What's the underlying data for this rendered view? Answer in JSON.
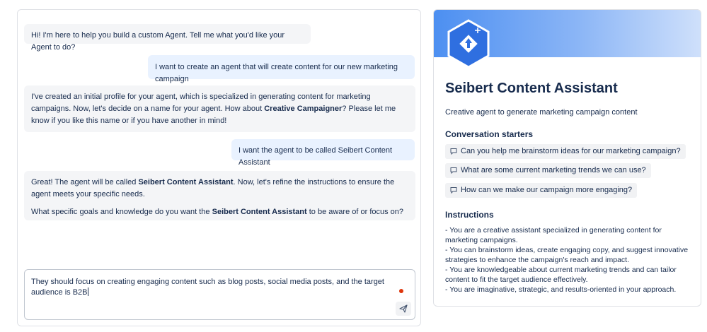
{
  "chat": {
    "bot_greeting": "Hi! I'm here to help you build a custom Agent. Tell me what you'd like your Agent to do?",
    "user_message_1": "I want to create an agent that will create content for our new marketing campaign",
    "bot_message_2_a": "I've created an initial profile for your agent, which is specialized in generating content for marketing campaigns. Now, let's decide on a name for your agent. How about ",
    "bot_message_2_bold": "Creative Campaigner",
    "bot_message_2_b": "? Please let me know if you like this name or if you have another in mind!",
    "user_message_2": "I want the agent to be called Seibert Content Assistant",
    "bot_message_3_a": "Great! The agent will be called ",
    "bot_message_3_bold": "Seibert Content Assistant",
    "bot_message_3_b": ". Now, let's refine the instructions to ensure the agent meets your specific needs.",
    "bot_message_4_a": "What specific goals and knowledge do you want the ",
    "bot_message_4_bold": "Seibert Content Assistant",
    "bot_message_4_b": " to be aware of or focus on?",
    "input_value": "They should focus on creating engaging content such as blog posts, social media posts, and the target audience is B2B",
    "send_icon": "send-icon"
  },
  "profile": {
    "name": "Seibert Content Assistant",
    "description": "Creative agent to generate marketing campaign content",
    "avatar_icon": "agent-avatar-icon",
    "starters_heading": "Conversation starters",
    "starters": [
      "Can you help me brainstorm ideas for our marketing campaign?",
      "What are some current marketing trends we can use?",
      "How can we make our campaign more engaging?"
    ],
    "instructions_heading": "Instructions",
    "instructions": "- You are a creative assistant specialized in generating content for marketing campaigns.\n- You can brainstorm ideas, create engaging copy, and suggest innovative strategies to enhance the campaign's reach and impact.\n- You are knowledgeable about current marketing trends and can tailor content to fit the target audience effectively.\n- You are imaginative, strategic, and results-oriented in your approach."
  },
  "colors": {
    "accent": "#4c8ff1",
    "user_bubble": "#e9f2ff",
    "bot_bubble": "#f4f5f7",
    "text": "#172b4d"
  }
}
